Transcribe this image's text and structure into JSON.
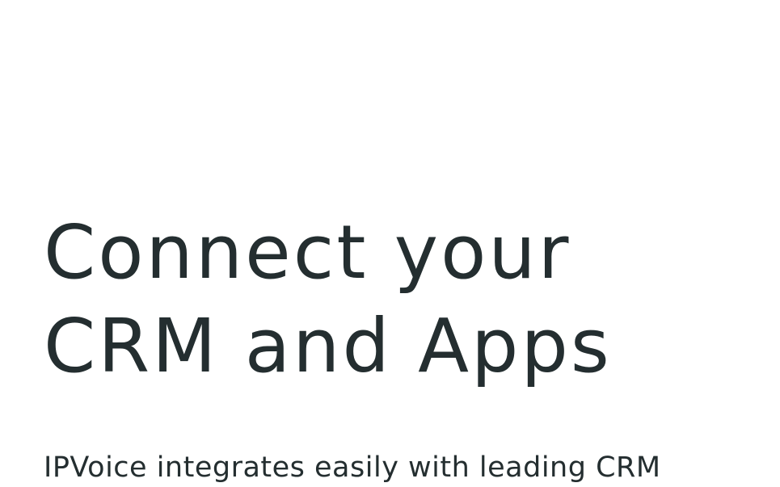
{
  "hero": {
    "title_line_1": "Connect your",
    "title_line_2": "CRM and Apps",
    "body": "IPVoice integrates easily with leading CRM"
  },
  "colors": {
    "text": "#242e30",
    "background": "#ffffff"
  }
}
